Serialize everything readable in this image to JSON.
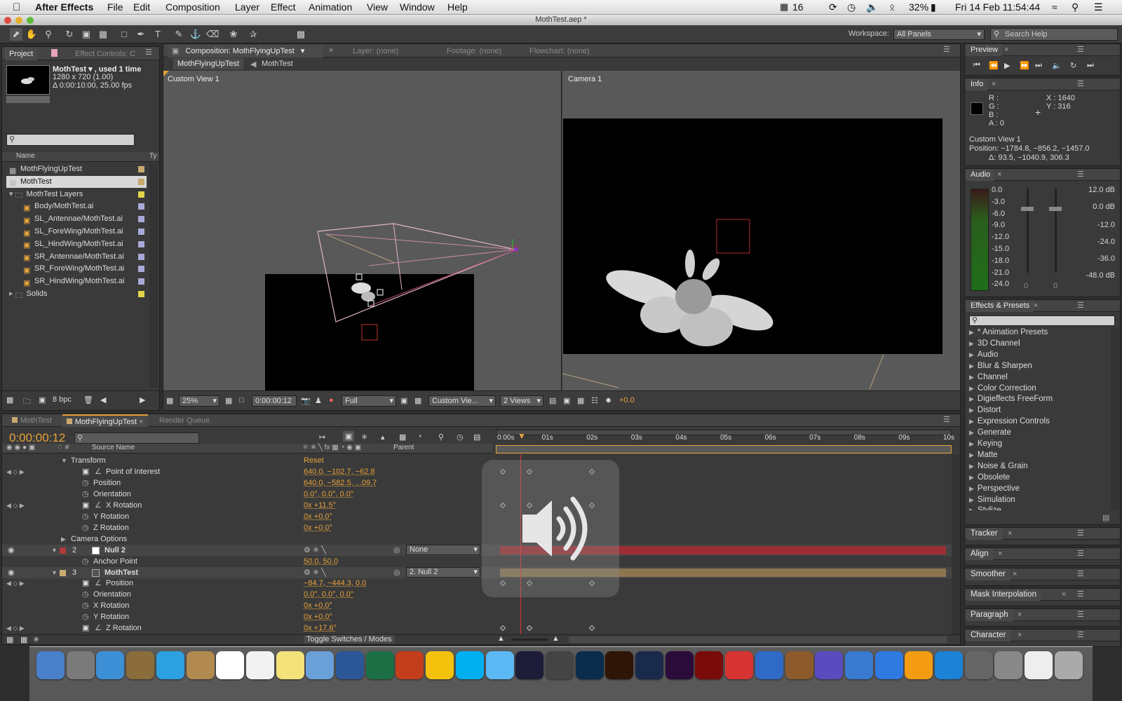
{
  "menubar": {
    "app": "After Effects",
    "items": [
      "File",
      "Edit",
      "Composition",
      "Layer",
      "Effect",
      "Animation",
      "View",
      "Window",
      "Help"
    ],
    "status": {
      "cal": "16",
      "battery": "32%",
      "clock": "Fri 14 Feb  11:54:44"
    }
  },
  "window_title": "MothTest.aep *",
  "toolbar": {
    "workspace_label": "Workspace:",
    "workspace_value": "All Panels",
    "search_placeholder": "Search Help"
  },
  "project": {
    "tab_project": "Project",
    "tab_effects": "Effect Controls: C",
    "item_name": "MothTest ▾ , used 1 time",
    "item_dims": "1280 x 720 (1.00)",
    "item_duration": "Δ 0:00:10:00, 25.00 fps",
    "col_name": "Name",
    "col_type": "Ty",
    "rows": [
      {
        "label": "MothFlyingUpTest",
        "indent": 0,
        "type": "comp",
        "color": "#c9a96e"
      },
      {
        "label": "MothTest",
        "indent": 0,
        "type": "comp",
        "color": "#c9a96e",
        "selected": true
      },
      {
        "label": "MothTest Layers",
        "indent": 0,
        "type": "folder",
        "color": "#e2d548"
      },
      {
        "label": "Body/MothTest.ai",
        "indent": 1,
        "type": "ai",
        "color": "#a9a9d9"
      },
      {
        "label": "SL_Antennae/MothTest.ai",
        "indent": 1,
        "type": "ai",
        "color": "#a9a9d9"
      },
      {
        "label": "SL_ForeWing/MothTest.ai",
        "indent": 1,
        "type": "ai",
        "color": "#a9a9d9"
      },
      {
        "label": "SL_HindWing/MothTest.ai",
        "indent": 1,
        "type": "ai",
        "color": "#a9a9d9"
      },
      {
        "label": "SR_Antennae/MothTest.ai",
        "indent": 1,
        "type": "ai",
        "color": "#a9a9d9"
      },
      {
        "label": "SR_ForeWing/MothTest.ai",
        "indent": 1,
        "type": "ai",
        "color": "#a9a9d9"
      },
      {
        "label": "SR_HindWing/MothTest.ai",
        "indent": 1,
        "type": "ai",
        "color": "#a9a9d9"
      },
      {
        "label": "Solids",
        "indent": 0,
        "type": "folder",
        "color": "#e2d548"
      }
    ],
    "bpc": "8 bpc"
  },
  "comp": {
    "tab": "Composition: MothFlyingUpTest",
    "layer_tab": "Layer: (none)",
    "footage_tab": "Footage: (none)",
    "flow_tab": "Flowchart: (none)",
    "crumb1": "MothFlyingUpTest",
    "crumb2": "MothTest",
    "view_left": "Custom View 1",
    "view_right": "Camera 1",
    "zoom": "25%",
    "timecode": "0:00:00:12",
    "resolution": "Full",
    "view_select": "Custom Vie...",
    "views": "2 Views",
    "exposure": "+0.0"
  },
  "preview": {
    "title": "Preview"
  },
  "info": {
    "title": "Info",
    "r": "R :",
    "g": "G :",
    "b": "B :",
    "a": "A : 0",
    "x": "X : 1640",
    "y": "Y : 316",
    "line1": "Custom View 1",
    "line2": "Position: −1784.8, −856.2, −1457.0",
    "line3": "Δ: 93.5, −1040.9, 306.3"
  },
  "audio": {
    "title": "Audio",
    "left_scale": [
      "0.0",
      "-3.0",
      "-6.0",
      "-9.0",
      "-12.0",
      "-15.0",
      "-18.0",
      "-21.0",
      "-24.0"
    ],
    "right_scale": [
      "12.0 dB",
      "0.0 dB",
      "-12.0",
      "-24.0",
      "-36.0",
      "-48.0 dB"
    ],
    "zero_left": "0",
    "zero_right": "0"
  },
  "effects": {
    "title": "Effects & Presets",
    "items": [
      "* Animation Presets",
      "3D Channel",
      "Audio",
      "Blur & Sharpen",
      "Channel",
      "Color Correction",
      "Digieffects FreeForm",
      "Distort",
      "Expression Controls",
      "Generate",
      "Keying",
      "Matte",
      "Noise & Grain",
      "Obsolete",
      "Perspective",
      "Simulation",
      "Stylize"
    ]
  },
  "collapsed_panels": [
    "Tracker",
    "Align",
    "Smoother",
    "Mask Interpolation",
    "Paragraph",
    "Character"
  ],
  "timeline": {
    "tabs": [
      "MothTest",
      "MothFlyingUpTest",
      "Render Queue"
    ],
    "timecode": "0:00:00:12",
    "col_source": "Source Name",
    "col_parent": "Parent",
    "ruler": [
      "0:00s",
      "01s",
      "02s",
      "03s",
      "04s",
      "05s",
      "06s",
      "07s",
      "08s",
      "09s",
      "10s"
    ],
    "rows": [
      {
        "kind": "group",
        "label": "Transform",
        "value": "Reset"
      },
      {
        "kind": "prop",
        "label": "Point of Interest",
        "value": "640.0, −102.7, −62.8",
        "kf": true
      },
      {
        "kind": "prop",
        "label": "Position",
        "value": "640.0, −582.5, ...09.7"
      },
      {
        "kind": "prop",
        "label": "Orientation",
        "value": "0.0°, 0.0°, 0.0°"
      },
      {
        "kind": "prop",
        "label": "X Rotation",
        "value": "0x +11.5°",
        "kf": true
      },
      {
        "kind": "prop",
        "label": "Y Rotation",
        "value": "0x +0.0°"
      },
      {
        "kind": "prop",
        "label": "Z Rotation",
        "value": "0x +0.0°"
      },
      {
        "kind": "group",
        "label": "Camera Options",
        "value": ""
      },
      {
        "kind": "layer",
        "num": "2",
        "label": "Null 2",
        "parent": "None"
      },
      {
        "kind": "prop",
        "label": "Anchor Point",
        "value": "50.0, 50.0"
      },
      {
        "kind": "layer",
        "num": "3",
        "label": "MothTest",
        "parent": "2. Null 2"
      },
      {
        "kind": "prop",
        "label": "Position",
        "value": "−84.7, −444.3, 0.0",
        "kf": true
      },
      {
        "kind": "prop",
        "label": "Orientation",
        "value": "0.0°, 0.0°, 0.0°"
      },
      {
        "kind": "prop",
        "label": "X Rotation",
        "value": "0x +0.0°"
      },
      {
        "kind": "prop",
        "label": "Y Rotation",
        "value": "0x +0.0°"
      },
      {
        "kind": "prop",
        "label": "Z Rotation",
        "value": "0x +17.6°",
        "kf": true
      }
    ],
    "toggle": "Toggle Switches / Modes"
  },
  "dock": [
    "Finder",
    "Launchpad",
    "Safari",
    "Preview",
    "Twitter",
    "Contacts",
    "Calendar",
    "Reminders",
    "Notes",
    "Photos",
    "Word",
    "Excel",
    "PowerPoint",
    "Drive",
    "Skype",
    "Messages",
    "Cinema4D",
    "Audio",
    "Photoshop",
    "Illustrator",
    "AE",
    "Premiere",
    "Flash",
    "Sketch",
    "QuickTime",
    "GarageBand",
    "iMovie",
    "iPhoto",
    "iTunes",
    "iBooks",
    "AppStore",
    "Time",
    "SysPrefs",
    "Docs",
    "Trash"
  ]
}
